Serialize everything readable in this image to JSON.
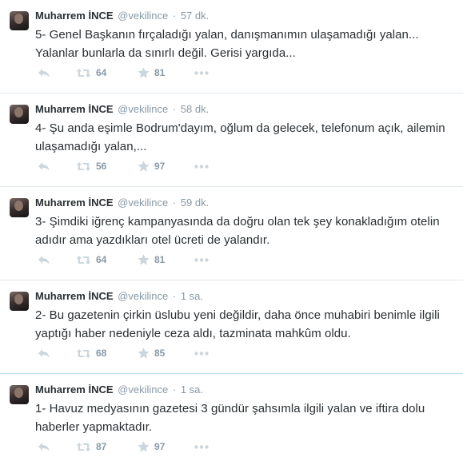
{
  "tweets": [
    {
      "name": "Muharrem İNCE",
      "handle": "@vekilince",
      "sep": "·",
      "time": "57 dk.",
      "text": "5- Genel Başkanın fırçaladığı yalan, danışmanımın ulaşamadığı yalan... Yalanlar bunlarla da sınırlı değil. Gerisi yargıda...",
      "retweets": "64",
      "favorites": "81"
    },
    {
      "name": "Muharrem İNCE",
      "handle": "@vekilince",
      "sep": "·",
      "time": "58 dk.",
      "text": "4- Şu anda eşimle Bodrum'dayım, oğlum da gelecek, telefonum açık, ailemin ulaşamadığı yalan,...",
      "retweets": "56",
      "favorites": "97"
    },
    {
      "name": "Muharrem İNCE",
      "handle": "@vekilince",
      "sep": "·",
      "time": "59 dk.",
      "text": "3- Şimdiki iğrenç kampanyasında da doğru olan tek şey konakladığım otelin adıdır ama yazdıkları otel ücreti de yalandır.",
      "retweets": "64",
      "favorites": "81"
    },
    {
      "name": "Muharrem İNCE",
      "handle": "@vekilince",
      "sep": "·",
      "time": "1 sa.",
      "text": "2- Bu gazetenin çirkin üslubu yeni değildir, daha önce muhabiri benimle ilgili yaptığı haber nedeniyle ceza aldı, tazminata mahkûm oldu.",
      "retweets": "68",
      "favorites": "85"
    },
    {
      "name": "Muharrem İNCE",
      "handle": "@vekilince",
      "sep": "·",
      "time": "1 sa.",
      "text": "1- Havuz medyasının gazetesi 3 gündür şahsımla ilgili yalan ve iftira dolu haberler yapmaktadır.",
      "retweets": "87",
      "favorites": "97"
    }
  ],
  "icons": {
    "reply": "reply-icon",
    "retweet": "retweet-icon",
    "favorite": "star-icon",
    "more": "more-icon"
  },
  "colors": {
    "name": "#292f33",
    "meta": "#8899a6",
    "icon": "#ccd6dd",
    "divider": "#e1e8ed"
  }
}
